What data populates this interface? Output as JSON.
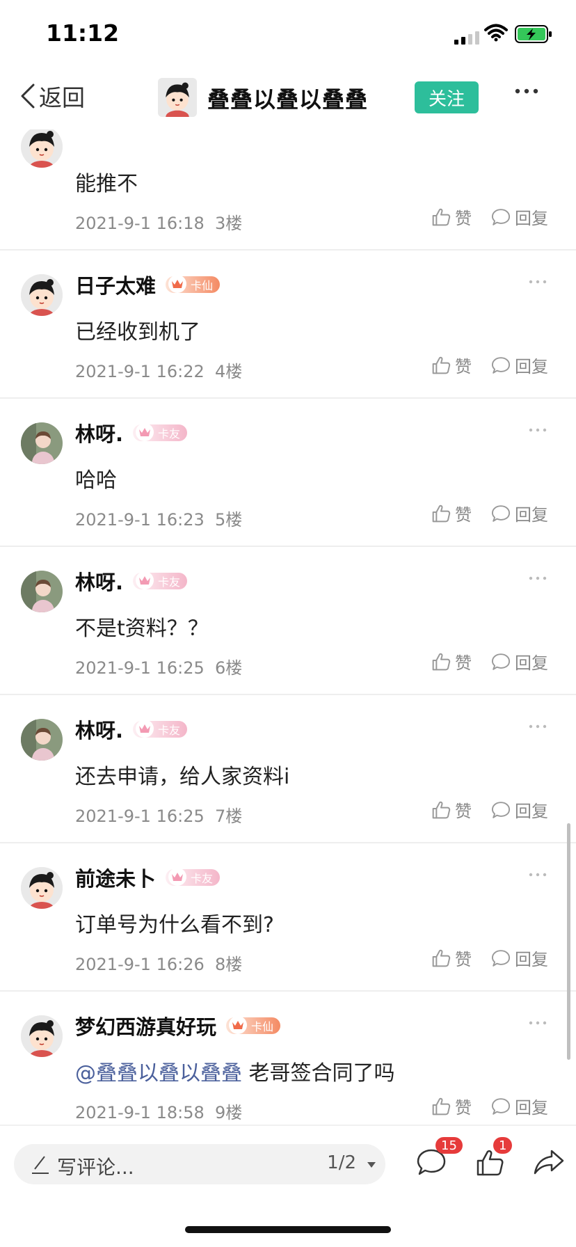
{
  "status_bar": {
    "time": "11:12"
  },
  "nav": {
    "back_label": "返回",
    "title": "叠叠以叠以叠叠",
    "follow_label": "关注"
  },
  "comments": [
    {
      "name": "",
      "badge": "",
      "badge_type": "",
      "text": "能推不",
      "date": "2021-9-1 16:18",
      "floor": "3楼",
      "avatar": "cartoon"
    },
    {
      "name": "日子太难",
      "badge": "卡仙",
      "badge_type": "xian",
      "text": "已经收到机了",
      "date": "2021-9-1 16:22",
      "floor": "4楼",
      "avatar": "cartoon"
    },
    {
      "name": "林呀.",
      "badge": "卡友",
      "badge_type": "you",
      "text": "哈哈",
      "date": "2021-9-1 16:23",
      "floor": "5楼",
      "avatar": "photo"
    },
    {
      "name": "林呀.",
      "badge": "卡友",
      "badge_type": "you",
      "text": "不是t资料？？",
      "date": "2021-9-1 16:25",
      "floor": "6楼",
      "avatar": "photo"
    },
    {
      "name": "林呀.",
      "badge": "卡友",
      "badge_type": "you",
      "text": "还去申请，给人家资料i",
      "date": "2021-9-1 16:25",
      "floor": "7楼",
      "avatar": "photo"
    },
    {
      "name": "前途未卜",
      "badge": "卡友",
      "badge_type": "you",
      "text": "订单号为什么看不到?",
      "date": "2021-9-1 16:26",
      "floor": "8楼",
      "avatar": "cartoon"
    },
    {
      "name": "梦幻西游真好玩",
      "badge": "卡仙",
      "badge_type": "xian",
      "mention": "@叠叠以叠以叠叠",
      "text": " 老哥签合同了吗",
      "date": "2021-9-1 18:58",
      "floor": "9楼",
      "avatar": "cartoon"
    }
  ],
  "actions": {
    "like_label": "赞",
    "reply_label": "回复"
  },
  "bottom_bar": {
    "placeholder": "写评论...",
    "page": "1/2",
    "comment_count": "15",
    "like_count": "1"
  },
  "colors": {
    "accent": "#2dbe9b",
    "mention": "#4a5f9b",
    "badge_red": "#e63b3b"
  }
}
